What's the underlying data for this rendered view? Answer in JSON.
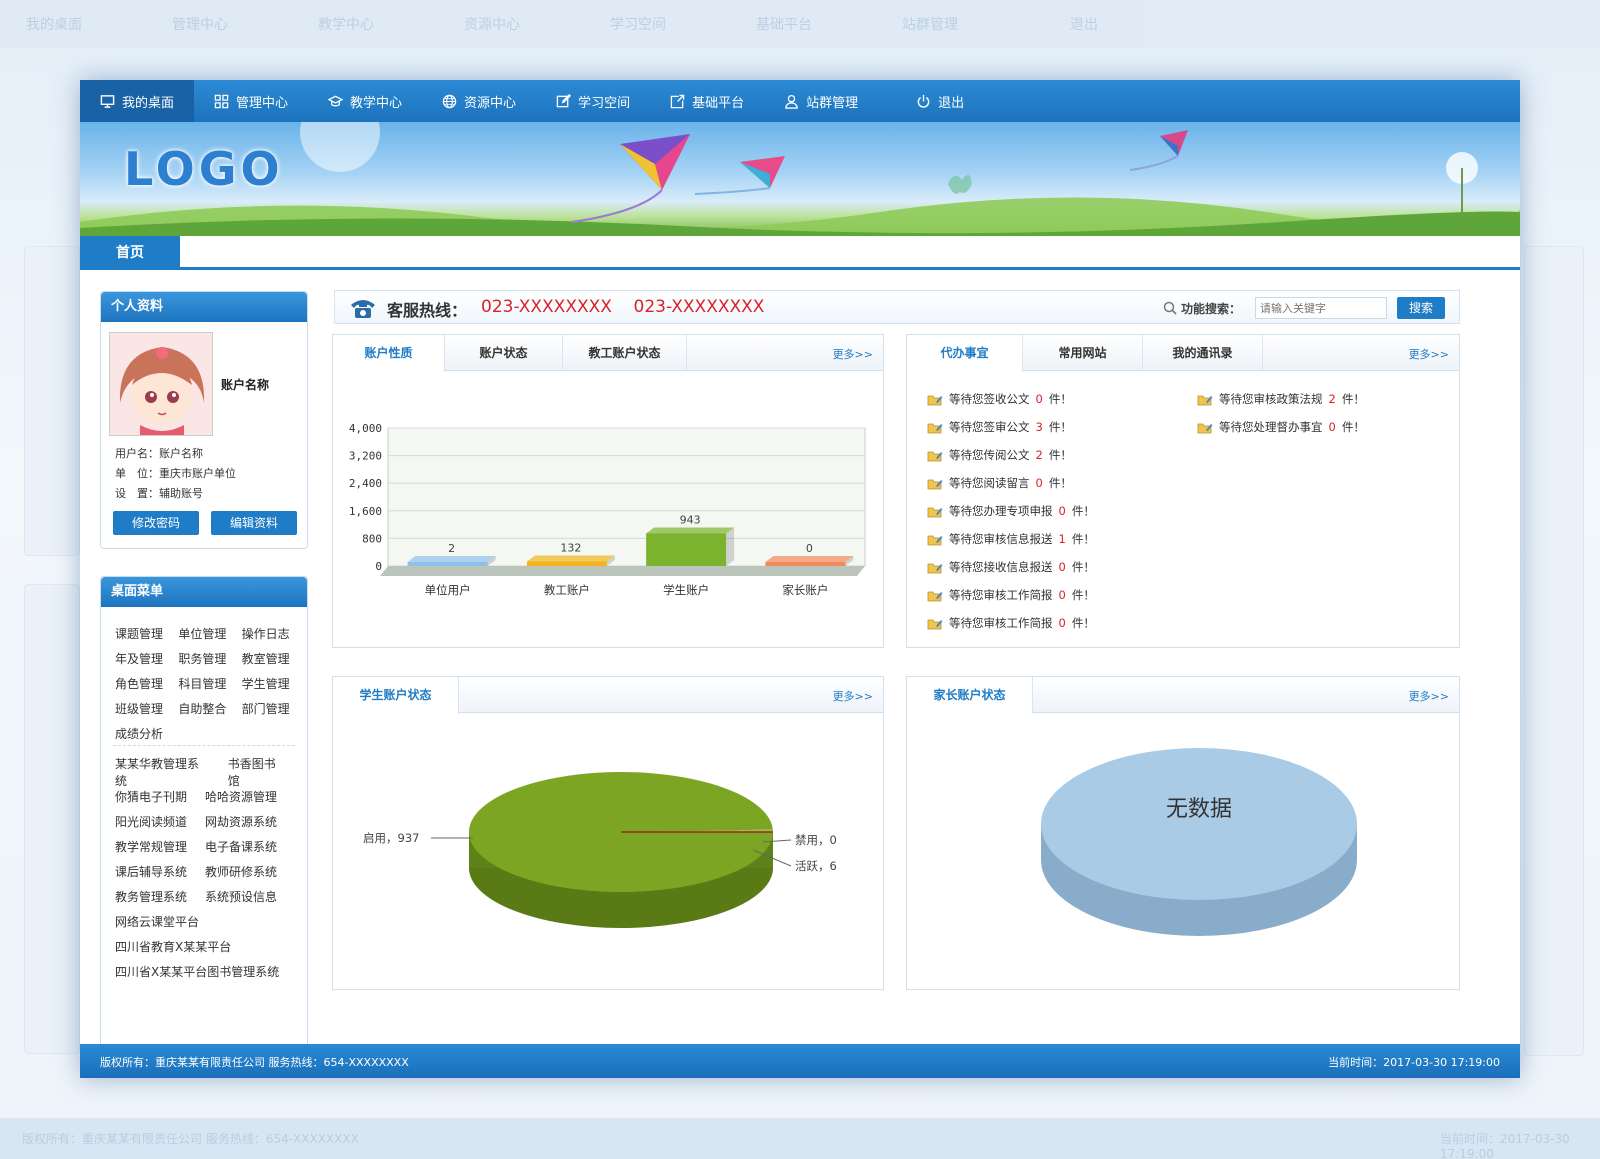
{
  "nav": {
    "items": [
      {
        "label": "我的桌面",
        "icon": "monitor-icon",
        "active": true
      },
      {
        "label": "管理中心",
        "icon": "grid-icon",
        "active": false
      },
      {
        "label": "教学中心",
        "icon": "graduation-cap-icon",
        "active": false
      },
      {
        "label": "资源中心",
        "icon": "globe-icon",
        "active": false
      },
      {
        "label": "学习空间",
        "icon": "edit-icon",
        "active": false
      },
      {
        "label": "基础平台",
        "icon": "external-edit-icon",
        "active": false
      },
      {
        "label": "站群管理",
        "icon": "user-icon",
        "active": false
      },
      {
        "label": "退出",
        "icon": "power-icon",
        "active": false
      }
    ]
  },
  "banner": {
    "logo": "LOGO"
  },
  "subnav": {
    "home": "首页"
  },
  "profile": {
    "title": "个人资料",
    "account_name": "账户名称",
    "username": "用户名：账户名称",
    "unit": "单　位：重庆市账户单位",
    "role": "设　置：辅助账号",
    "change_password": "修改密码",
    "edit_profile": "编辑资料"
  },
  "menu": {
    "title": "桌面菜单",
    "grid": [
      [
        "课题管理",
        "单位管理",
        "操作日志"
      ],
      [
        "年及管理",
        "职务管理",
        "教室管理"
      ],
      [
        "角色管理",
        "科目管理",
        "学生管理"
      ],
      [
        "班级管理",
        "自助整合",
        "部门管理"
      ],
      [
        "成绩分析"
      ]
    ],
    "systems": [
      [
        "某某华教管理系统",
        "书香图书馆"
      ],
      [
        "你猜电子刊期",
        "哈哈资源管理"
      ],
      [
        "阳光阅读频道",
        "网劫资源系统"
      ],
      [
        "教学常规管理",
        "电子备课系统"
      ],
      [
        "课后辅导系统",
        "教师研修系统"
      ],
      [
        "教务管理系统",
        "系统预设信息"
      ],
      [
        "网络云课堂平台"
      ],
      [
        "四川省教育X某某平台"
      ],
      [
        "四川省X某某平台图书管理系统"
      ]
    ]
  },
  "hotline": {
    "label": "客服热线：",
    "numbers": "023-XXXXXXXX    023-XXXXXXXX",
    "search_label": "功能搜索：",
    "search_placeholder": "请输入关键字",
    "search_button": "搜索"
  },
  "account_box": {
    "tabs": [
      "账户性质",
      "账户状态",
      "教工账户状态"
    ],
    "more": "更多>>"
  },
  "todo_box": {
    "tabs": [
      "代办事宜",
      "常用网站",
      "我的通讯录"
    ],
    "more": "更多>>",
    "left_items": [
      {
        "text": "等待您签收公文",
        "count": "0",
        "unit": "件！"
      },
      {
        "text": "等待您签审公文",
        "count": "3",
        "unit": "件！"
      },
      {
        "text": "等待您传阅公文",
        "count": "2",
        "unit": "件！"
      },
      {
        "text": "等待您阅读留言",
        "count": "0",
        "unit": "件！"
      },
      {
        "text": "等待您办理专项申报",
        "count": "0",
        "unit": "件！"
      },
      {
        "text": "等待您审核信息报送",
        "count": "1",
        "unit": "件！"
      },
      {
        "text": "等待您接收信息报送",
        "count": "0",
        "unit": "件！"
      },
      {
        "text": "等待您审核工作简报",
        "count": "0",
        "unit": "件！"
      },
      {
        "text": "等待您审核工作简报",
        "count": "0",
        "unit": "件！"
      }
    ],
    "right_items": [
      {
        "text": "等待您审核政策法规",
        "count": "2",
        "unit": "件！"
      },
      {
        "text": "等待您处理督办事宜",
        "count": "0",
        "unit": "件！"
      }
    ]
  },
  "student_box": {
    "title": "学生账户状态",
    "more": "更多>>"
  },
  "parent_box": {
    "title": "家长账户状态",
    "more": "更多>>",
    "empty": "无数据"
  },
  "footer": {
    "left": "版权所有：重庆某某有限责任公司  服务热线：654-XXXXXXXX",
    "right": "当前时间：2017-03-30 17:19:00"
  },
  "colors": {
    "primary": "#1f7cc6",
    "accent_red": "#d9232a",
    "pie_green": "#7da524",
    "pie_blue": "#a9cbe6"
  },
  "chart_data": [
    {
      "type": "bar",
      "categories": [
        "单位用户",
        "教工账户",
        "学生账户",
        "家长账户"
      ],
      "values": [
        2,
        132,
        943,
        0
      ],
      "colors": [
        "#8ec0ea",
        "#f2b51c",
        "#7cb32e",
        "#f08a5b"
      ],
      "ylim": [
        0,
        4000
      ],
      "yticks": [
        "0",
        "800",
        "1,600",
        "2,400",
        "3,200",
        "4,000"
      ],
      "grid": true
    },
    {
      "type": "pie",
      "labels": [
        "启用",
        "禁用",
        "活跃"
      ],
      "values": [
        937,
        0,
        6
      ],
      "label_texts": [
        "启用，937",
        "禁用，0",
        "活跃，6"
      ]
    }
  ]
}
